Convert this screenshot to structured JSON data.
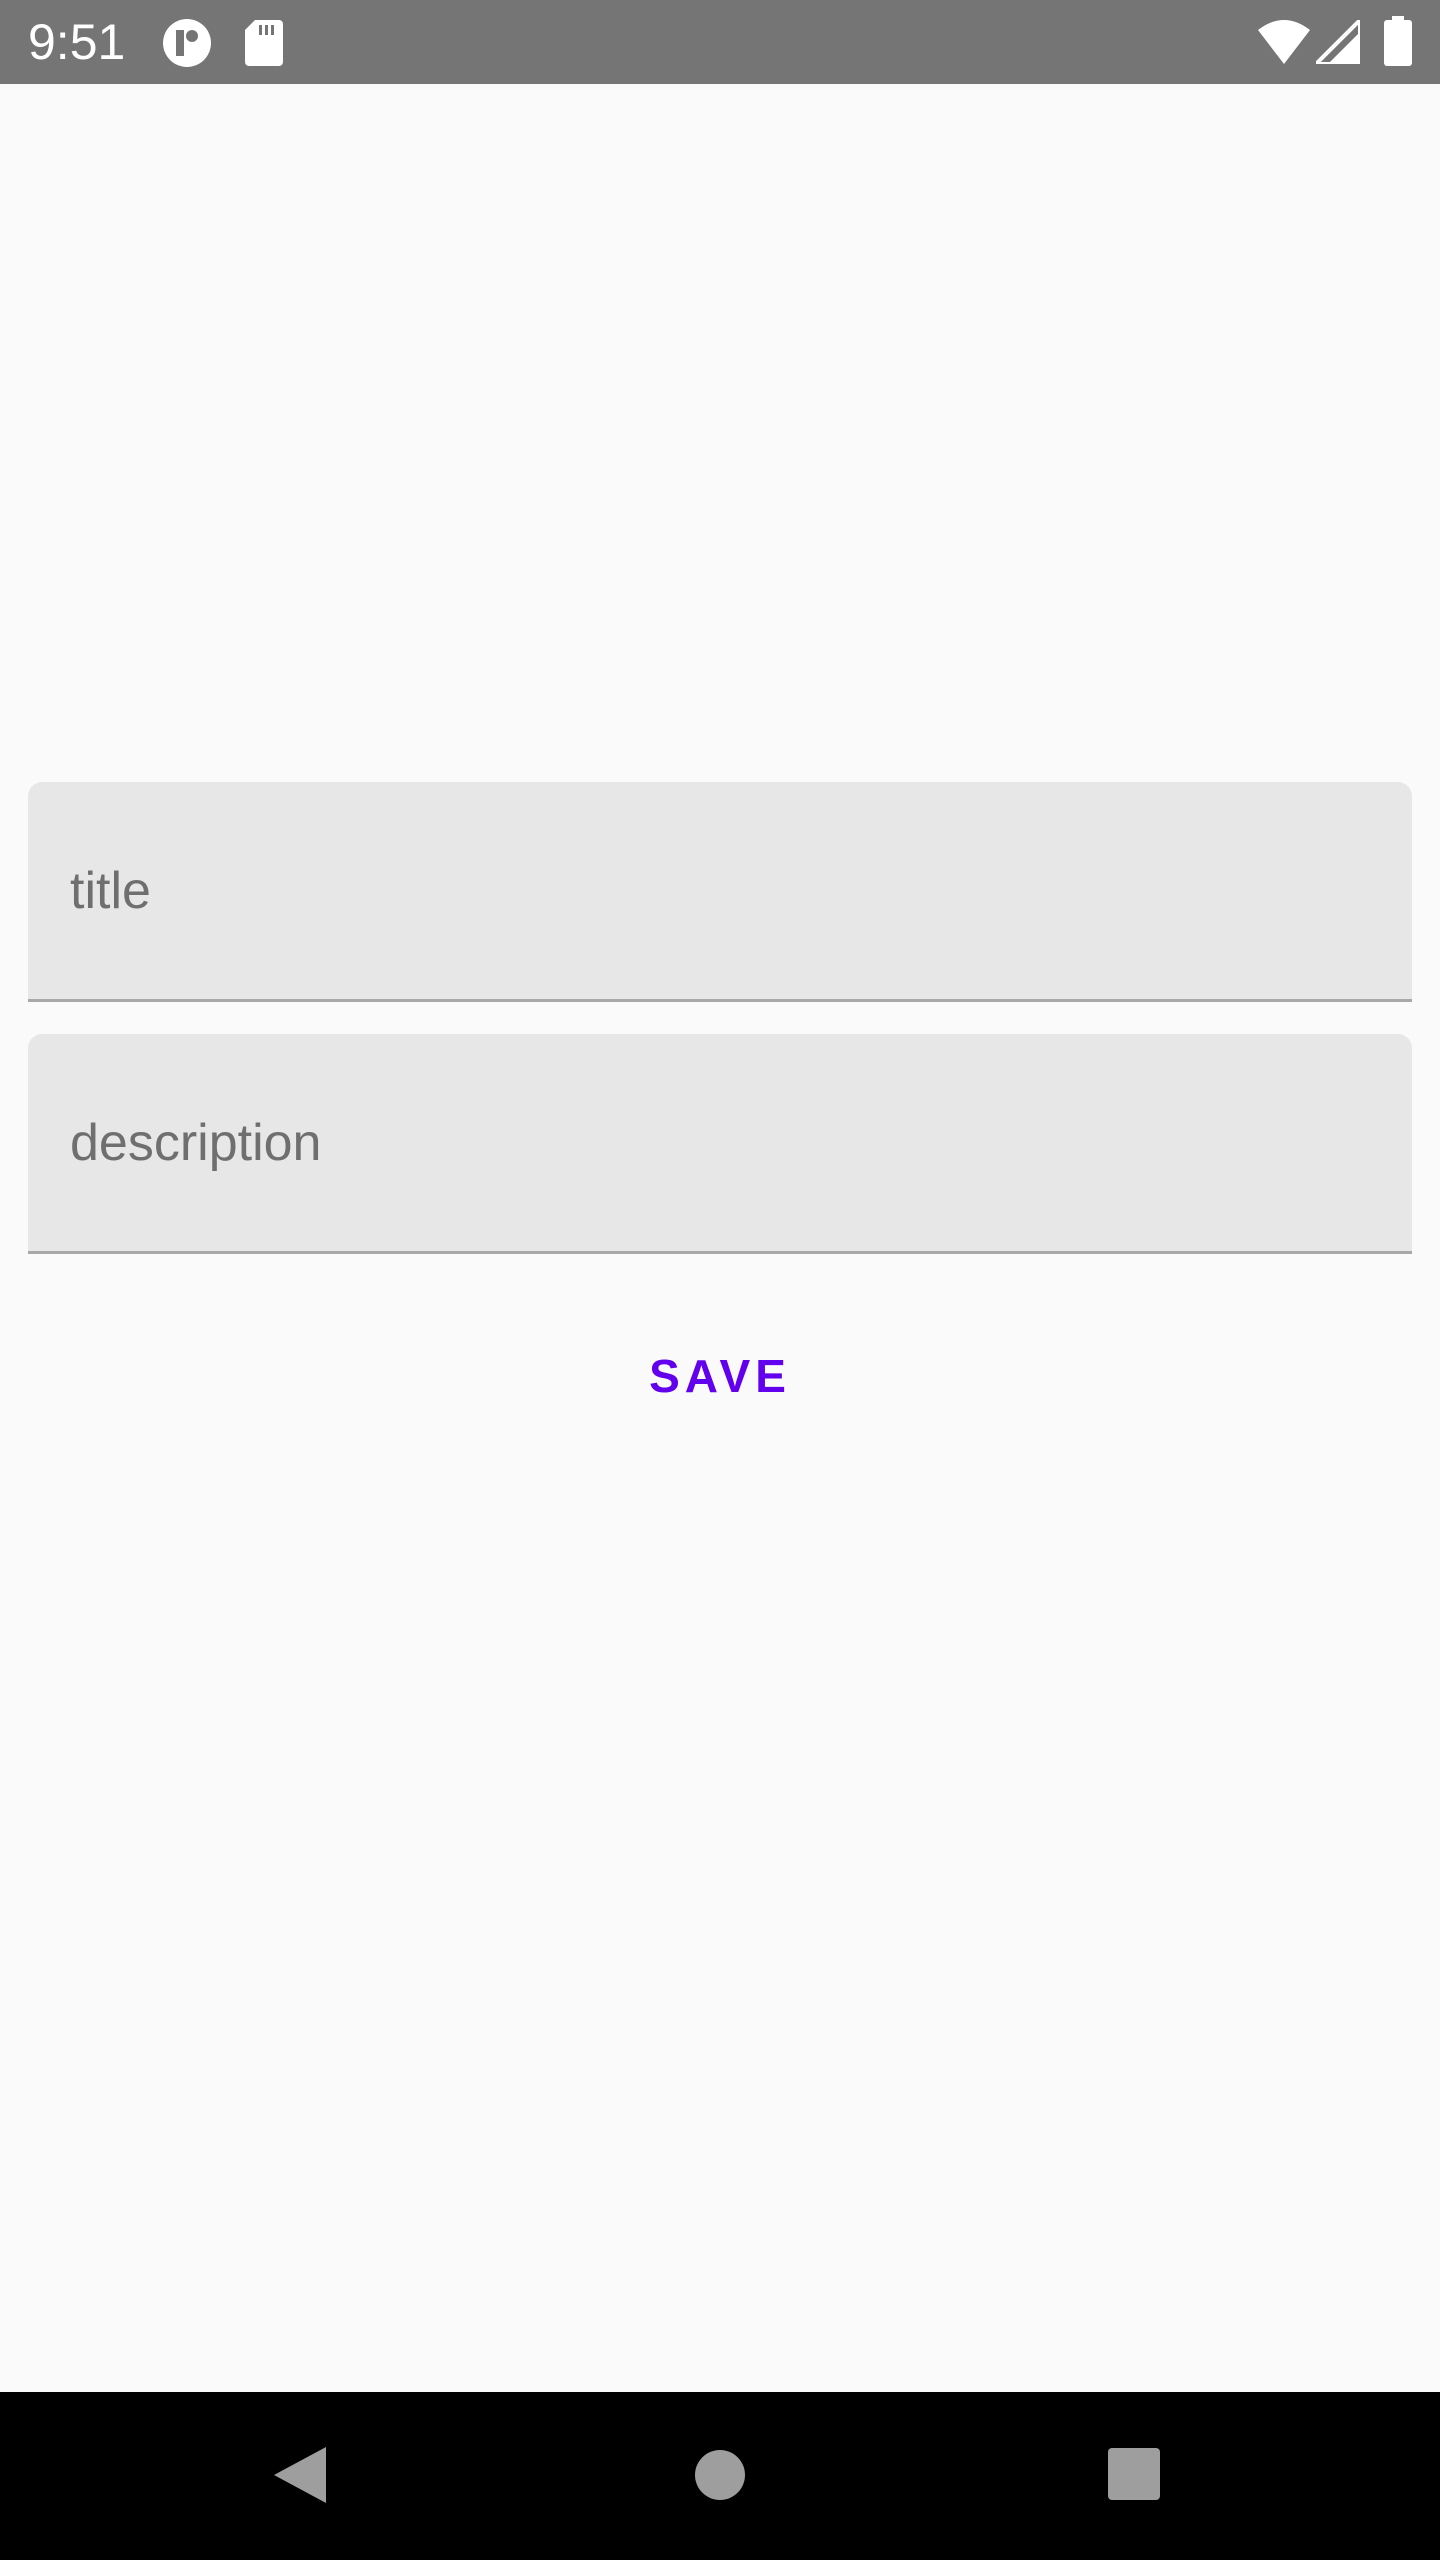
{
  "status_bar": {
    "time": "9:51",
    "background_color": "#757575",
    "icons": [
      "notification-app-icon",
      "sd-card-icon",
      "wifi-icon",
      "cellular-signal-icon",
      "battery-icon"
    ]
  },
  "form": {
    "title_field": {
      "placeholder": "title",
      "value": ""
    },
    "description_field": {
      "placeholder": "description",
      "value": ""
    },
    "save_label": "SAVE",
    "accent_color": "#6200ee",
    "field_background": "#e7e7e7"
  },
  "nav_bar": {
    "buttons": [
      "back-icon",
      "home-icon",
      "recents-icon"
    ]
  }
}
